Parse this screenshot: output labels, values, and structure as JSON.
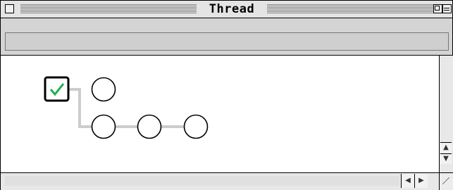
{
  "window": {
    "title": "Thread"
  },
  "thread": {
    "root": {
      "checked": true,
      "check_color": "#22b14c"
    },
    "nodes": [
      {
        "row": 0,
        "col": 1
      },
      {
        "row": 1,
        "col": 1
      },
      {
        "row": 1,
        "col": 2
      },
      {
        "row": 1,
        "col": 3
      }
    ],
    "connector_color": "#cccccc"
  },
  "scrollbars": {
    "vertical": {
      "up_icon": "arrow-up-icon",
      "down_icon": "arrow-down-icon"
    },
    "horizontal": {
      "left_icon": "arrow-left-icon",
      "right_icon": "arrow-right-icon"
    }
  }
}
